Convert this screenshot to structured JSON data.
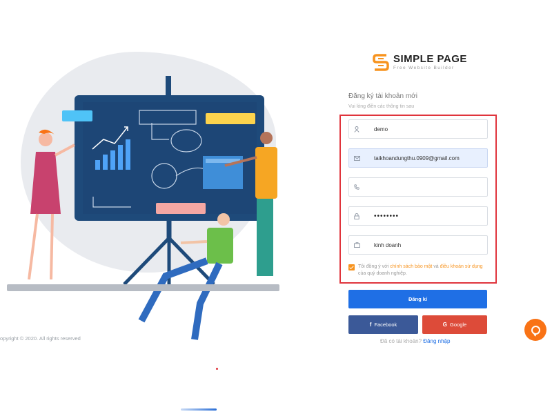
{
  "illustration": {
    "copyright": "opyright © 2020. All rights reserved"
  },
  "brand": {
    "name": "SIMPLE PAGE",
    "tagline": "Free Website Builder"
  },
  "form": {
    "title": "Đăng ký tài khoản mới",
    "subtitle": "Vui lòng điền các thông tin sau",
    "fields": [
      {
        "icon": "user-icon",
        "value": "demo",
        "placeholder": ""
      },
      {
        "icon": "envelope-icon",
        "value": "taikhoandungthu.0909@gmail.com",
        "placeholder": ""
      },
      {
        "icon": "phone-icon",
        "value": "",
        "placeholder": ""
      },
      {
        "icon": "lock-icon",
        "value": "••••••••",
        "placeholder": ""
      },
      {
        "icon": "briefcase-icon",
        "value": "kinh doanh",
        "placeholder": ""
      }
    ],
    "agree": {
      "prefix": "Tôi đồng ý với",
      "privacy_link": "chính sách bảo mật",
      "and": "và",
      "terms_link": "điều khoản sử dụng",
      "suffix": "của quý doanh nghiệp."
    },
    "submit_label": "Đăng kí",
    "facebook_label": "Facebook",
    "google_label": "Google",
    "have_account": "Đã có tài khoản?",
    "login_link": "Đăng nhập"
  },
  "colors": {
    "primary": "#1f6fe5",
    "facebook": "#3b5998",
    "google": "#dd4b39",
    "accent": "#f7931e",
    "highlight": "#e0343c",
    "chat": "#f97316",
    "board": "#1e4a7a"
  }
}
